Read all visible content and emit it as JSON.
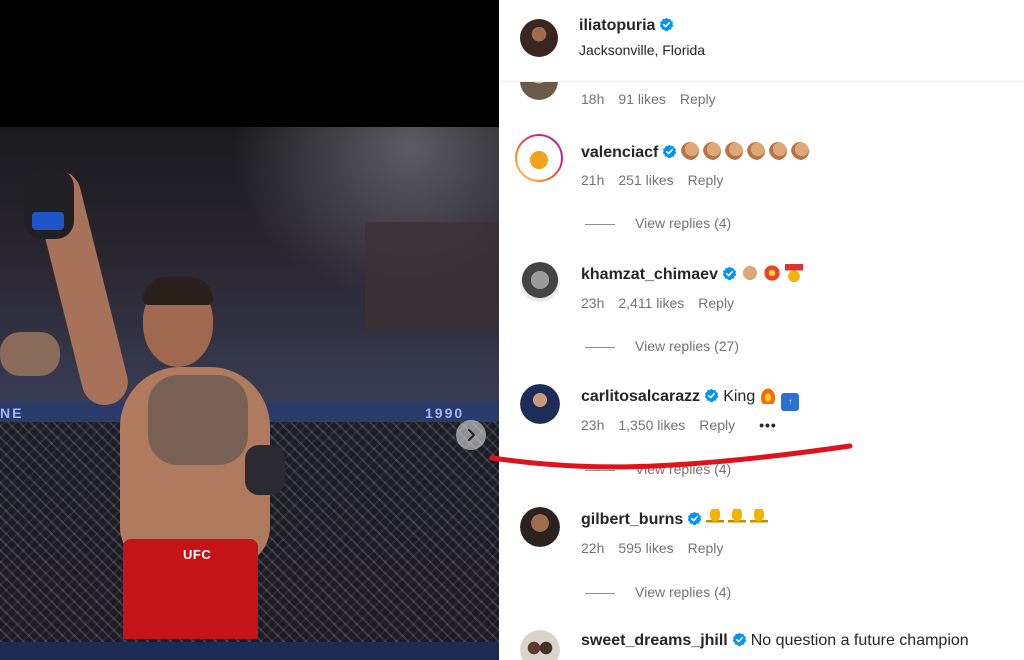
{
  "post": {
    "username": "iliatopuria",
    "location": "Jacksonville, Florida",
    "media": {
      "shorts_logo": "UFC",
      "cage_text_left": "NE",
      "cage_text_right": "1990"
    }
  },
  "comments": [
    {
      "username": "",
      "text": "",
      "time": "18h",
      "likes": "91 likes",
      "reply_label": "Reply",
      "partial": true
    },
    {
      "username": "valenciacf",
      "verified": true,
      "text": "",
      "emojis": [
        "flexed-biceps",
        "flexed-biceps",
        "flexed-biceps",
        "flexed-biceps",
        "flexed-biceps",
        "flexed-biceps"
      ],
      "time": "21h",
      "likes": "251 likes",
      "reply_label": "Reply",
      "view_replies": "View replies (4)"
    },
    {
      "username": "khamzat_chimaev",
      "verified": true,
      "text": "",
      "emojis": [
        "fist",
        "collision",
        "medal"
      ],
      "time": "23h",
      "likes": "2,411 likes",
      "reply_label": "Reply",
      "view_replies": "View replies (27)"
    },
    {
      "username": "carlitosalcarazz",
      "verified": true,
      "text": "King",
      "emojis": [
        "fire",
        "top-arrow"
      ],
      "time": "23h",
      "likes": "1,350 likes",
      "reply_label": "Reply",
      "more_label": "•••",
      "view_replies": "View replies (4)"
    },
    {
      "username": "gilbert_burns",
      "verified": true,
      "text": "",
      "emojis": [
        "trophy",
        "trophy",
        "trophy"
      ],
      "time": "22h",
      "likes": "595 likes",
      "reply_label": "Reply",
      "view_replies": "View replies (4)"
    },
    {
      "username": "sweet_dreams_jhill",
      "verified": true,
      "text": "No question a future champion"
    }
  ],
  "colors": {
    "verified": "#0095f6",
    "annotation": "#e0131c",
    "muted_text": "#737373"
  },
  "icons": {
    "next": "chevron-right-icon",
    "verified": "verified-badge-icon"
  }
}
